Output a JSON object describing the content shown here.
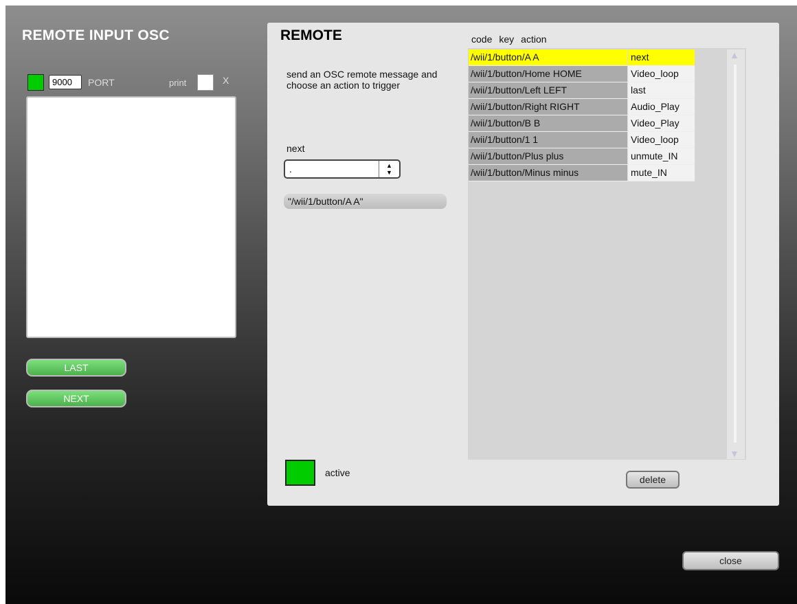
{
  "left_panel": {
    "title": "REMOTE INPUT OSC",
    "port_value": "9000",
    "port_label": "PORT",
    "print_label": "print",
    "print_x": "X",
    "last_label": "LAST",
    "next_label": "NEXT"
  },
  "remote_panel": {
    "title": "REMOTE",
    "description": "send an OSC remote message and choose an action to trigger",
    "selected_action_label": "next",
    "select_value": ".",
    "message_display": "\"/wii/1/button/A A\"",
    "active_label": "active"
  },
  "table": {
    "headers": [
      "code",
      "key",
      "action"
    ],
    "rows": [
      {
        "code": "/wii/1/button/A A",
        "action": "next"
      },
      {
        "code": "/wii/1/button/Home HOME",
        "action": "Video_loop"
      },
      {
        "code": "/wii/1/button/Left LEFT",
        "action": "last"
      },
      {
        "code": "/wii/1/button/Right RIGHT",
        "action": "Audio_Play"
      },
      {
        "code": "/wii/1/button/B B",
        "action": "Video_Play"
      },
      {
        "code": "/wii/1/button/1 1",
        "action": "Video_loop"
      },
      {
        "code": "/wii/1/button/Plus plus",
        "action": "unmute_IN"
      },
      {
        "code": "/wii/1/button/Minus minus",
        "action": "mute_IN"
      }
    ],
    "selected_row": 0,
    "scroll_up_glyph": "▲",
    "scroll_down_glyph": "▼"
  },
  "buttons": {
    "delete_label": "delete",
    "close_label": "close"
  },
  "colors": {
    "active_green": "#00cc00",
    "selected_row": "#ffff00"
  }
}
